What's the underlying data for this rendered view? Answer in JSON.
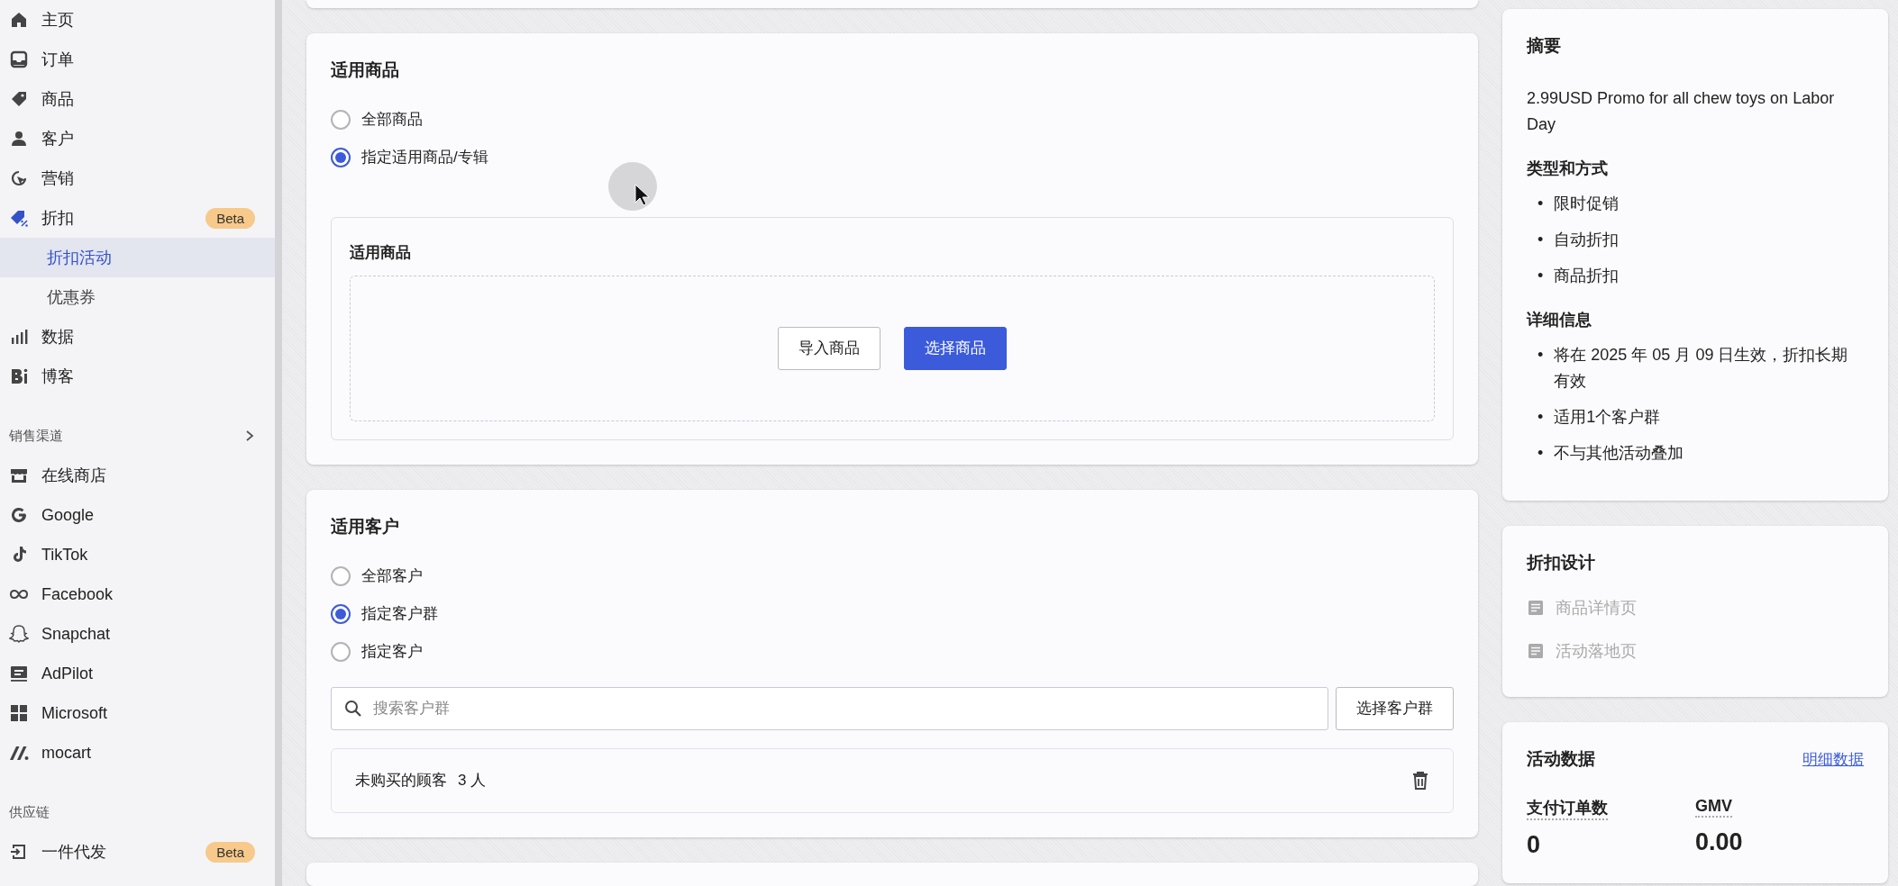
{
  "sidebar": {
    "sections": [
      {
        "items": [
          {
            "label": "主页",
            "selected": false
          },
          {
            "label": "订单",
            "selected": false
          },
          {
            "label": "商品",
            "selected": false
          },
          {
            "label": "客户",
            "selected": false
          },
          {
            "label": "营销",
            "selected": false
          },
          {
            "label": "折扣",
            "selected": false,
            "badge": "Beta",
            "children": [
              {
                "label": "折扣活动",
                "selected": true
              },
              {
                "label": "优惠券",
                "selected": false
              }
            ]
          },
          {
            "label": "数据",
            "selected": false
          },
          {
            "label": "博客",
            "selected": false
          }
        ]
      },
      {
        "header": "销售渠道",
        "items": [
          {
            "label": "在线商店",
            "selected": false
          },
          {
            "label": "Google",
            "selected": false
          },
          {
            "label": "TikTok",
            "selected": false
          },
          {
            "label": "Facebook",
            "selected": false
          },
          {
            "label": "Snapchat",
            "selected": false
          },
          {
            "label": "AdPilot",
            "selected": false
          },
          {
            "label": "Microsoft",
            "selected": false
          },
          {
            "label": "mocart",
            "selected": false
          }
        ]
      },
      {
        "header": "供应链",
        "items": [
          {
            "label": "一件代发",
            "selected": false,
            "badge": "Beta"
          }
        ]
      }
    ]
  },
  "products": {
    "title": "适用商品",
    "options": [
      {
        "label": "全部商品",
        "selected": false
      },
      {
        "label": "指定适用商品/专辑",
        "selected": true
      }
    ],
    "panel": {
      "title": "适用商品",
      "buttons": [
        {
          "label": "导入商品",
          "kind": "secondary"
        },
        {
          "label": "选择商品",
          "kind": "primary"
        }
      ]
    }
  },
  "customers": {
    "title": "适用客户",
    "options": [
      {
        "label": "全部客户",
        "selected": false
      },
      {
        "label": "指定客户群",
        "selected": true
      },
      {
        "label": "指定客户",
        "selected": false
      }
    ],
    "search": {
      "placeholder": "搜索客户群"
    },
    "button": "选择客户群",
    "groups": [
      {
        "name": "未购买的顾客",
        "count": "3 人"
      }
    ]
  },
  "summary": {
    "title": "摘要",
    "description": "2.99USD Promo for all chew toys on Labor Day",
    "sections": [
      {
        "heading": "类型和方式",
        "bullets": [
          {
            "marker": "•",
            "text": "限时促销"
          },
          {
            "marker": "•",
            "text": "自动折扣"
          },
          {
            "marker": "•",
            "text": "商品折扣"
          }
        ]
      },
      {
        "heading": "详细信息",
        "bullets": [
          {
            "marker": "•",
            "text": "将在 2025 年 05 月 09 日生效，折扣长期有效"
          },
          {
            "marker": "•",
            "text": "适用1个客户群"
          },
          {
            "marker": "•",
            "text": "不与其他活动叠加"
          }
        ]
      }
    ]
  },
  "design": {
    "title": "折扣设计",
    "items": [
      {
        "label": "商品详情页",
        "disabled": true
      },
      {
        "label": "活动落地页",
        "disabled": true
      }
    ]
  },
  "stats": {
    "title": "活动数据",
    "link": "明细数据",
    "metrics": [
      {
        "label": "支付订单数",
        "value": "0"
      },
      {
        "label": "GMV",
        "value": "0.00"
      }
    ]
  }
}
